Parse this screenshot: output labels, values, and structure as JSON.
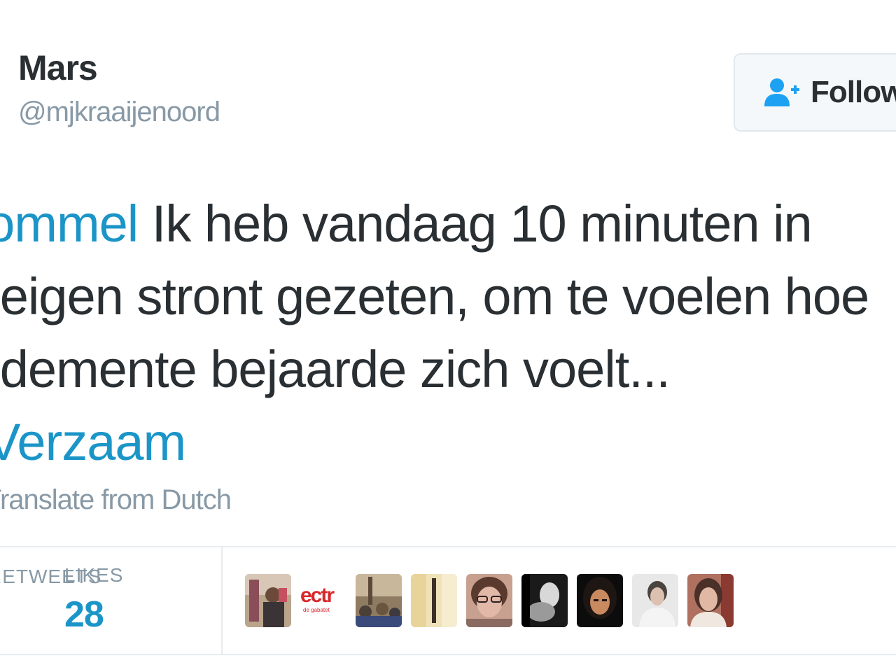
{
  "user": {
    "display_name": "Mars",
    "handle": "@mjkraaijenoord"
  },
  "follow_button": {
    "label": "Follow",
    "icon": "add-user-icon"
  },
  "tweet": {
    "line1_mention": "bommel",
    "line1_text": " Ik heb vandaag 10 minuten in",
    "line2_text": "n eigen stront gezeten, om te voelen hoe",
    "line3_text": "n demente bejaarde zich voelt...",
    "line4_hashtag": "#Verzaam"
  },
  "translate": {
    "label": "Translate from Dutch"
  },
  "stats": {
    "partial_label": "RETWEETS",
    "likes_label": "LIKES",
    "likes_value": "28"
  },
  "likers": [
    {
      "name": "liker-1"
    },
    {
      "name": "liker-2",
      "text": "ectr",
      "subtext": "de gabatet"
    },
    {
      "name": "liker-3"
    },
    {
      "name": "liker-4"
    },
    {
      "name": "liker-5"
    },
    {
      "name": "liker-6"
    },
    {
      "name": "liker-7"
    },
    {
      "name": "liker-8"
    },
    {
      "name": "liker-9"
    }
  ],
  "colors": {
    "link": "#1b95c8",
    "text": "#292f33",
    "muted": "#8899a6",
    "follow_icon": "#1da1f2"
  }
}
